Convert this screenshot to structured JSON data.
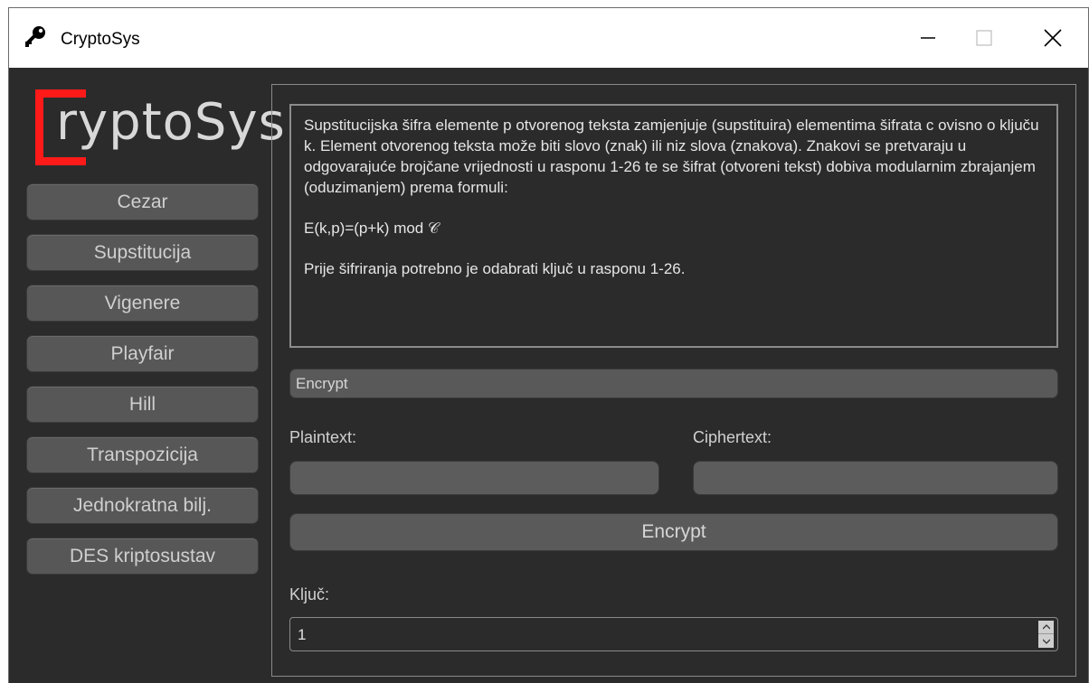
{
  "window": {
    "title": "CryptoSys",
    "minimize_glyph": "—",
    "close_glyph": "✕"
  },
  "logo": {
    "text": "ryptoSys",
    "bracket_color": "#ff1a1a"
  },
  "sidebar": {
    "items": [
      {
        "label": "Cezar"
      },
      {
        "label": "Supstitucija"
      },
      {
        "label": "Vigenere"
      },
      {
        "label": "Playfair"
      },
      {
        "label": "Hill"
      },
      {
        "label": "Transpozicija"
      },
      {
        "label": "Jednokratna bilj."
      },
      {
        "label": "DES kriptosustav"
      }
    ]
  },
  "main": {
    "description": {
      "paragraph1": "Supstitucijska šifra elemente p otvorenog teksta zamjenjuje (supstituira) elementima šifrata c ovisno o ključu k. Element otvorenog teksta može biti slovo (znak) ili niz slova (znakova). Znakovi se pretvaraju u odgovarajuće brojčane vrijednosti u rasponu 1-26 te se šifrat (otvoreni tekst) dobiva modularnim zbrajanjem (oduzimanjem) prema formuli:",
      "formula": "E(k,p)=(p+k) mod 𝒞",
      "paragraph2": "Prije šifriranja potrebno je odabrati ključ u rasponu 1-26."
    },
    "mode_select": {
      "value": "Encrypt"
    },
    "plaintext_label": "Plaintext:",
    "ciphertext_label": "Ciphertext:",
    "plaintext_value": "",
    "ciphertext_value": "",
    "action_button": "Encrypt",
    "key_label": "Ključ:",
    "key_value": "1"
  }
}
